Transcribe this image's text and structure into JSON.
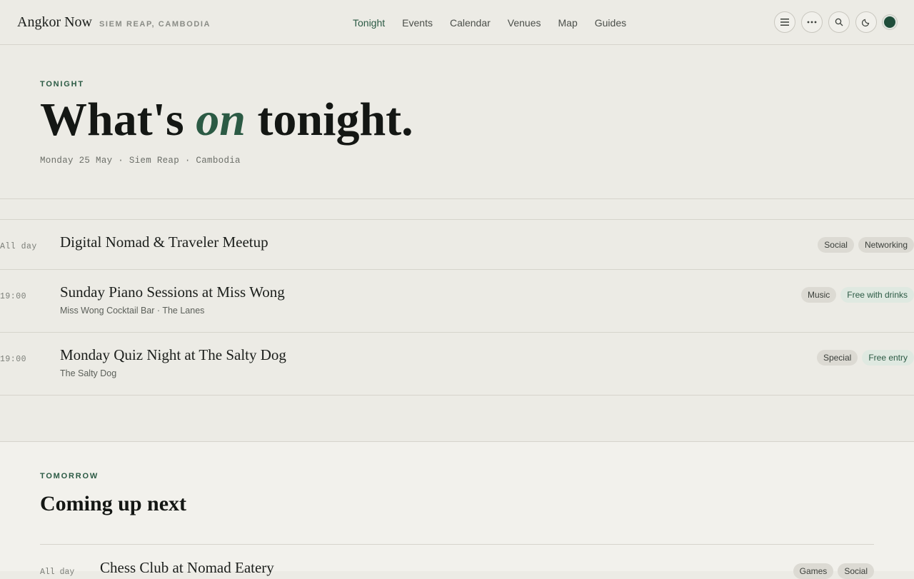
{
  "header": {
    "brand": "Angkor Now",
    "location": "SIEM REAP, CAMBODIA",
    "nav": [
      {
        "label": "Tonight",
        "active": true
      },
      {
        "label": "Events",
        "active": false
      },
      {
        "label": "Calendar",
        "active": false
      },
      {
        "label": "Venues",
        "active": false
      },
      {
        "label": "Map",
        "active": false
      },
      {
        "label": "Guides",
        "active": false
      }
    ],
    "icons": [
      "menu-icon",
      "more-icon",
      "search-icon",
      "moon-icon",
      "accent-dot"
    ]
  },
  "hero": {
    "eyebrow": "TONIGHT",
    "headline_pre": "What's ",
    "headline_em": "on",
    "headline_post": " tonight.",
    "meta": "Monday 25 May · Siem Reap · Cambodia"
  },
  "tonight_events": [
    {
      "time": "All day",
      "title": "Digital Nomad & Traveler Meetup",
      "venue": "",
      "tags": [
        {
          "label": "Social",
          "style": "neutral"
        },
        {
          "label": "Networking",
          "style": "neutral"
        }
      ]
    },
    {
      "time": "19:00",
      "title": "Sunday Piano Sessions at Miss Wong",
      "venue": "Miss Wong Cocktail Bar · The Lanes",
      "tags": [
        {
          "label": "Music",
          "style": "neutral"
        },
        {
          "label": "Free with drinks",
          "style": "green"
        }
      ]
    },
    {
      "time": "19:00",
      "title": "Monday Quiz Night at The Salty Dog",
      "venue": "The Salty Dog",
      "tags": [
        {
          "label": "Special",
          "style": "neutral"
        },
        {
          "label": "Free entry",
          "style": "green"
        }
      ]
    }
  ],
  "tomorrow": {
    "eyebrow": "TOMORROW",
    "title": "Coming up next",
    "events": [
      {
        "time": "All day",
        "title": "Chess Club at Nomad Eatery",
        "tags": [
          {
            "label": "Games",
            "style": "neutral"
          },
          {
            "label": "Social",
            "style": "neutral"
          }
        ]
      }
    ]
  },
  "colors": {
    "accent": "#2b5a44",
    "background": "#ecebe5",
    "tag_neutral": "#dcdad3",
    "tag_green": "#dfe9e1"
  }
}
